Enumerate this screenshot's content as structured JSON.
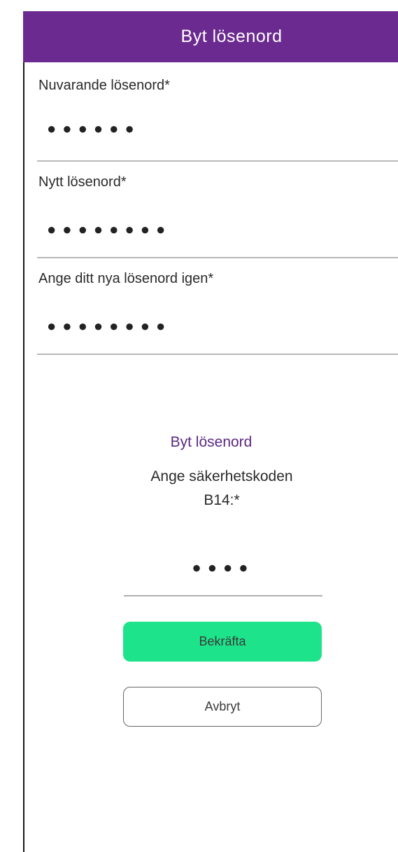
{
  "header": {
    "title": "Byt lösenord"
  },
  "form": {
    "current_password": {
      "label": "Nuvarande lösenord*",
      "value": "●●●●●●"
    },
    "new_password": {
      "label": "Nytt lösenord*",
      "value": "●●●●●●●●"
    },
    "confirm_password": {
      "label": "Ange ditt nya lösenord igen*",
      "value": "●●●●●●●●"
    }
  },
  "dialog": {
    "title": "Byt lösenord",
    "prompt_line1": "Ange säkerhetskoden",
    "prompt_line2": "B14:*",
    "code_value": "●●●●",
    "confirm_label": "Bekräfta",
    "cancel_label": "Avbryt"
  },
  "colors": {
    "header_bg": "#6b2a8f",
    "dialog_title": "#5b2a82",
    "confirm_bg": "#1de38a"
  }
}
